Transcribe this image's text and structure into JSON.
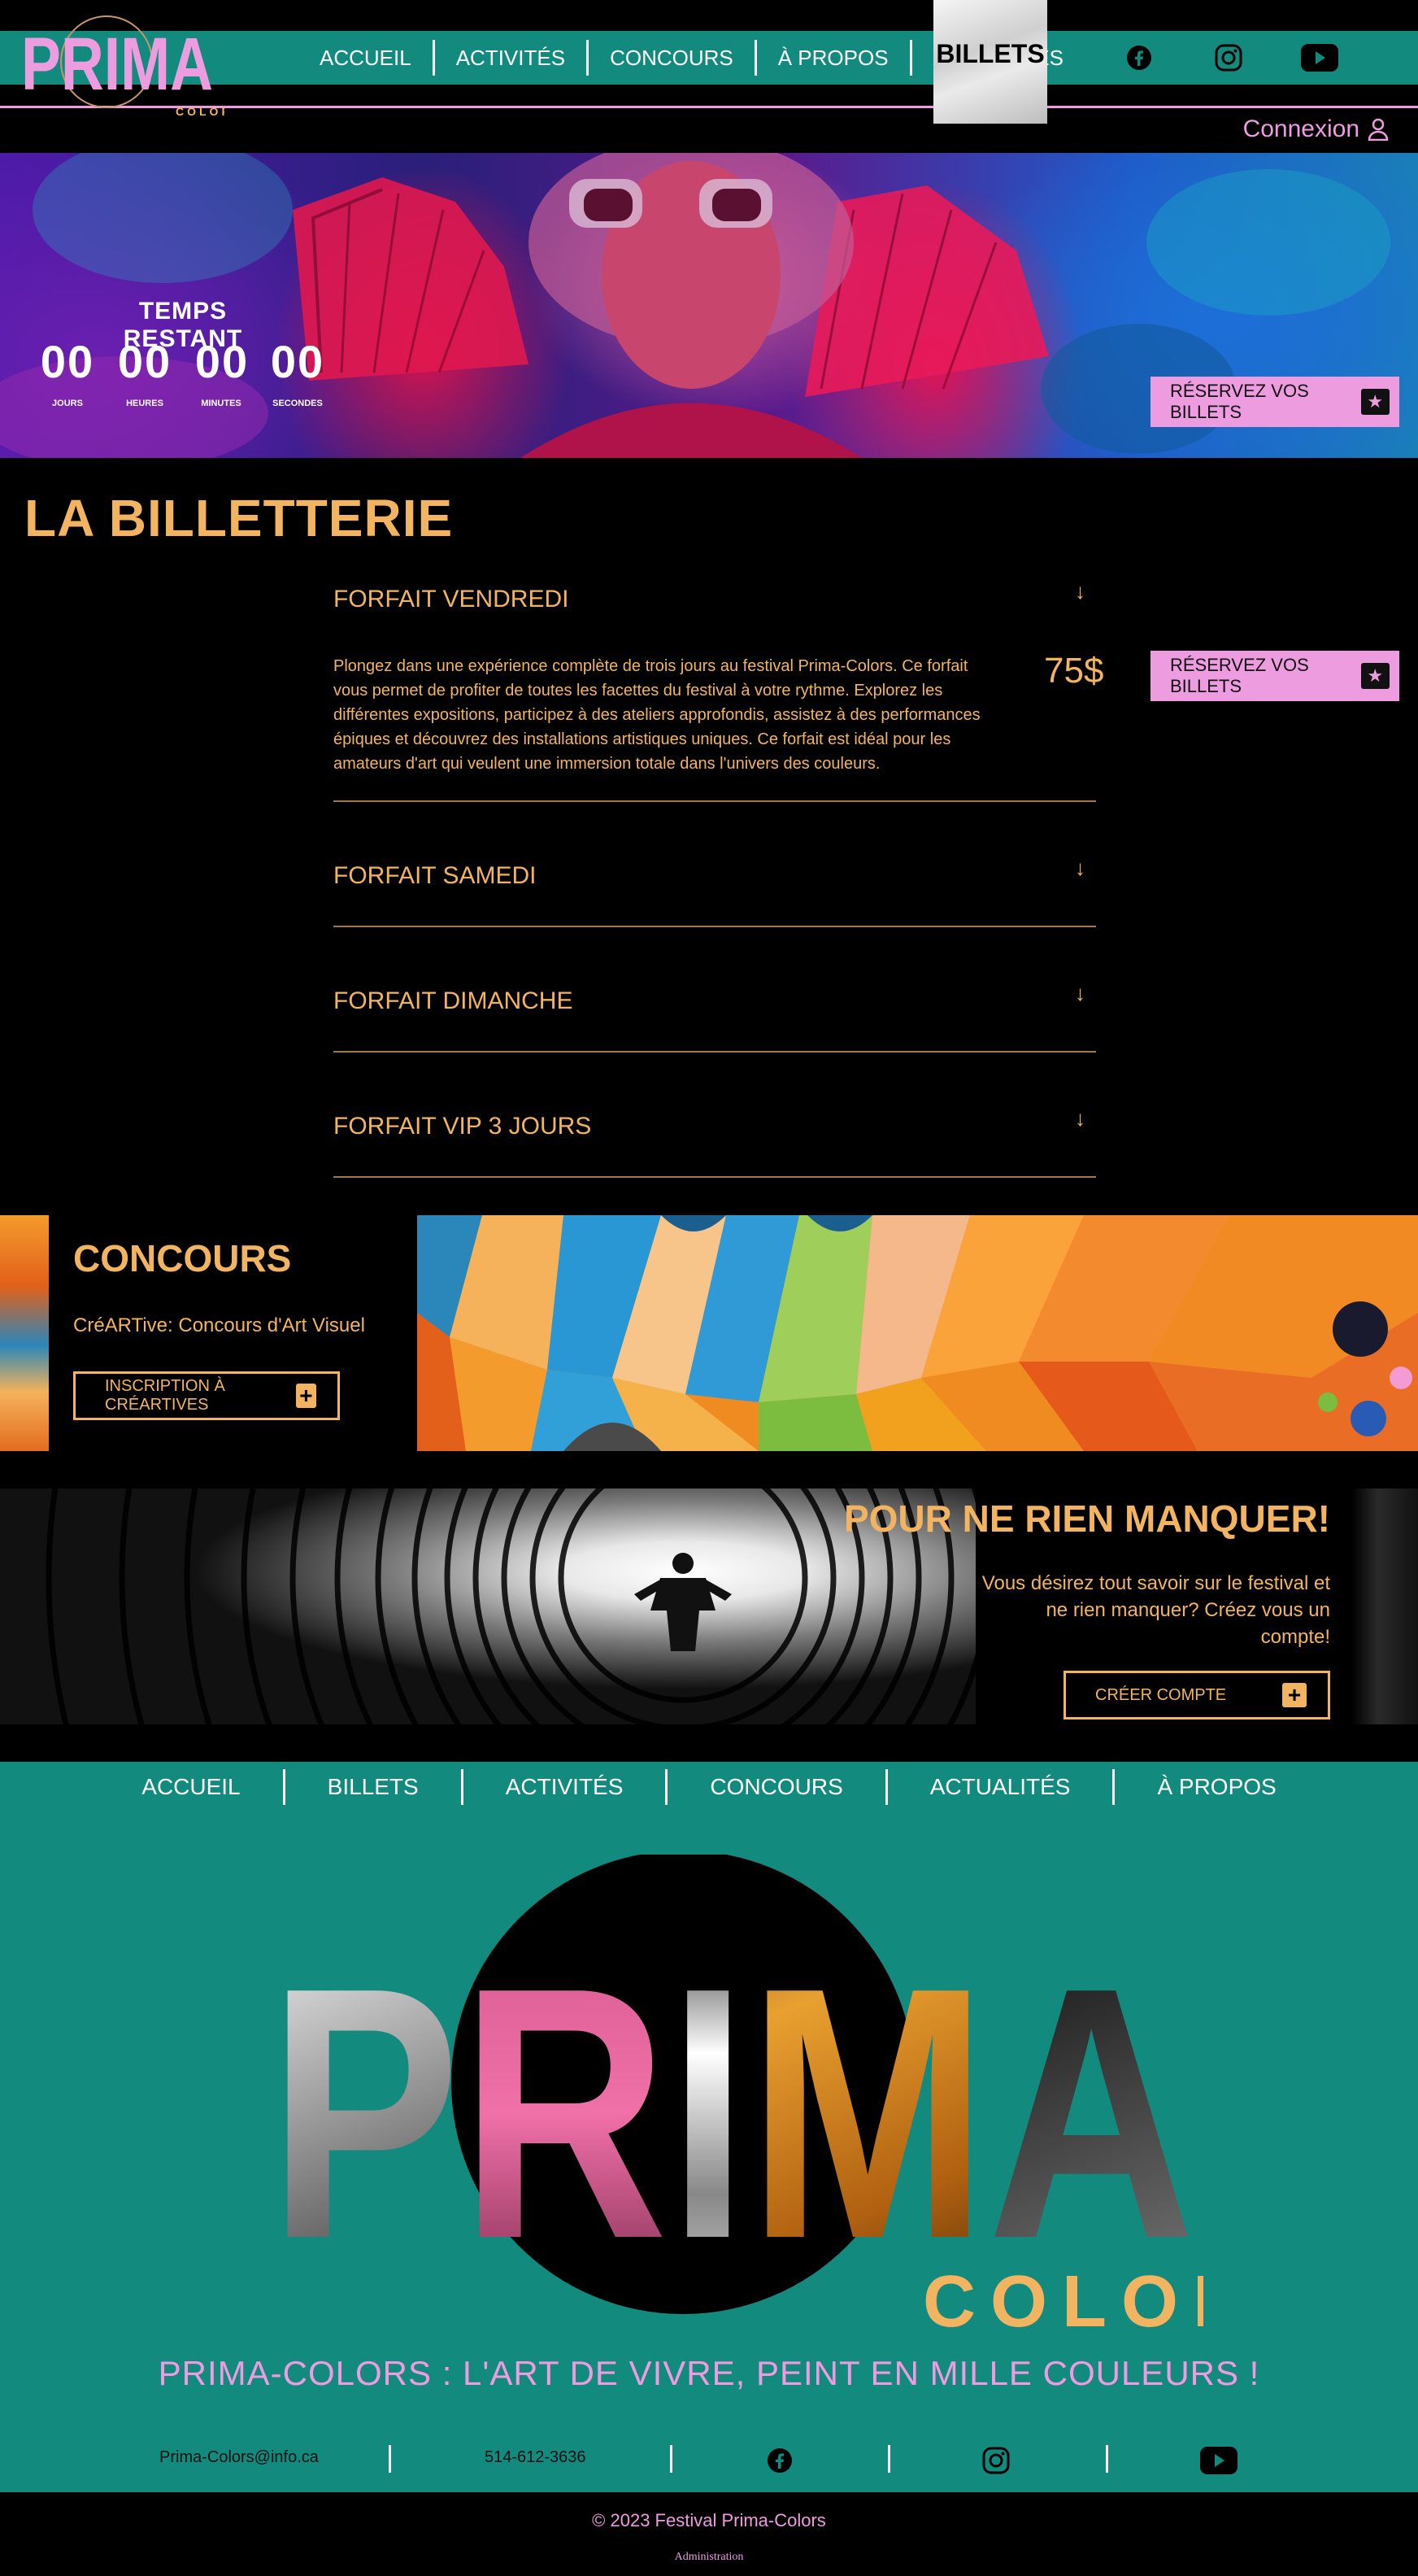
{
  "header": {
    "logo_main": "PRIMA",
    "logo_sub": "COLORS",
    "nav": [
      "ACCUEIL",
      "ACTIVITÉS",
      "CONCOURS",
      "À PROPOS",
      "ACTUALITÉS"
    ],
    "billets_tab": "BILLETS",
    "social_icons": [
      "facebook-icon",
      "instagram-icon",
      "youtube-icon"
    ],
    "connexion": "Connexion"
  },
  "hero": {
    "timer_title": "TEMPS RESTANT",
    "timer": [
      {
        "value": "00",
        "label": "JOURS"
      },
      {
        "value": "00",
        "label": "HEURES"
      },
      {
        "value": "00",
        "label": "MINUTES"
      },
      {
        "value": "00",
        "label": "SECONDES"
      }
    ],
    "reserve_label": "RÉSERVEZ VOS BILLETS"
  },
  "billetterie": {
    "title": "LA BILLETTERIE",
    "forfaits": [
      {
        "name": "FORFAIT VENDREDI",
        "expanded": true
      },
      {
        "name": "FORFAIT SAMEDI",
        "expanded": false
      },
      {
        "name": "FORFAIT DIMANCHE",
        "expanded": false
      },
      {
        "name": "FORFAIT VIP 3 JOURS",
        "expanded": false
      }
    ],
    "description": "Plongez dans une expérience complète de trois jours au festival Prima-Colors. Ce forfait vous permet de profiter de toutes les facettes du festival à votre rythme. Explorez les différentes expositions, participez à des ateliers approfondis, assistez à des performances épiques et découvrez des installations artistiques uniques. Ce forfait est idéal pour les amateurs d'art qui veulent une immersion totale dans l'univers des couleurs.",
    "price": "75$",
    "reserve_label": "RÉSERVEZ VOS BILLETS",
    "arrow": "↓"
  },
  "concours": {
    "title": "CONCOURS",
    "subtitle": "CréARTive: Concours d'Art Visuel",
    "button": "INSCRIPTION À CRÉARTIVES"
  },
  "newsletter": {
    "title": "POUR NE RIEN MANQUER!",
    "text": "Vous désirez tout savoir sur le festival et ne rien manquer? Créez vous un compte!",
    "button": "CRÉER COMPTE"
  },
  "footer": {
    "nav": [
      "ACCUEIL",
      "BILLETS",
      "ACTIVITÉS",
      "CONCOURS",
      "ACTUALITÉS",
      "À PROPOS"
    ],
    "logo_main": "PRIMA",
    "logo_sub": "COLORS",
    "slogan": "PRIMA-COLORS : L'ART DE VIVRE, PEINT EN MILLE COULEURS !",
    "email": "Prima-Colors@info.ca",
    "phone": "514-612-3636",
    "social_icons": [
      "facebook-icon",
      "instagram-icon",
      "youtube-icon"
    ],
    "copyright": "© 2023 Festival Prima-Colors",
    "admin": "Administration"
  },
  "colors": {
    "teal": "#138a7e",
    "pink": "#ee9ce0",
    "gold": "#f3b462",
    "black": "#000000"
  }
}
